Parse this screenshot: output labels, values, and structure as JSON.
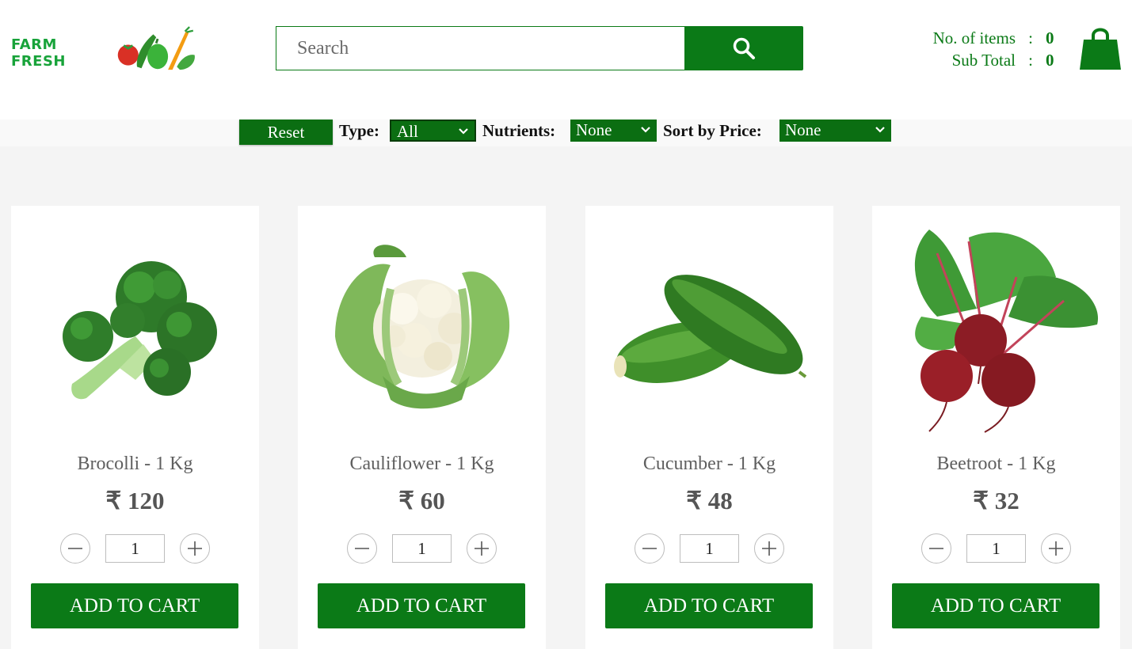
{
  "brand": {
    "name": "FARM FRESH",
    "color": "#18a33a",
    "logo_icon": "vegetables-logo-icon"
  },
  "search": {
    "placeholder": "Search",
    "value": "",
    "button_icon": "search-icon"
  },
  "cart": {
    "items_label": "No. of items",
    "items_value": "0",
    "subtotal_label": "Sub Total",
    "subtotal_value": "0",
    "separator": ":",
    "bag_icon": "shopping-bag-icon"
  },
  "filters": {
    "reset_label": "Reset",
    "type_label": "Type:",
    "type_value": "All",
    "nutrients_label": "Nutrients:",
    "nutrients_value": "None",
    "sort_label": "Sort by Price:",
    "sort_value": "None"
  },
  "products": [
    {
      "name": "Brocolli - 1 Kg",
      "price": "₹ 120",
      "qty": "1",
      "add_label": "ADD TO CART",
      "image_icon": "broccoli-image"
    },
    {
      "name": "Cauliflower - 1 Kg",
      "price": "₹ 60",
      "qty": "1",
      "add_label": "ADD TO CART",
      "image_icon": "cauliflower-image"
    },
    {
      "name": "Cucumber - 1 Kg",
      "price": "₹ 48",
      "qty": "1",
      "add_label": "ADD TO CART",
      "image_icon": "cucumber-image"
    },
    {
      "name": "Beetroot - 1 Kg",
      "price": "₹ 32",
      "qty": "1",
      "add_label": "ADD TO CART",
      "image_icon": "beetroot-image"
    }
  ],
  "colors": {
    "accent": "#0b7a17",
    "filter_green": "#0b6e12",
    "background": "#f4f4f4"
  }
}
